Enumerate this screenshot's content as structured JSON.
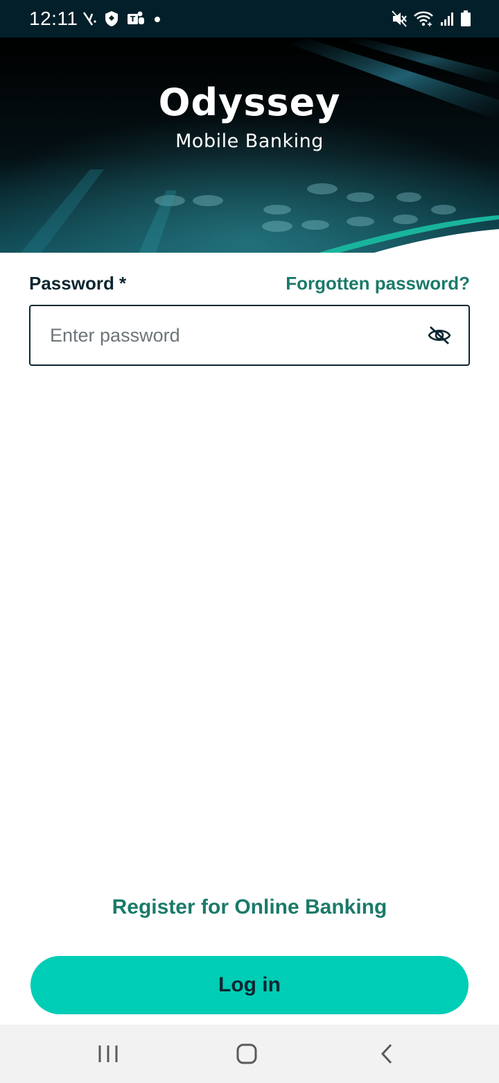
{
  "status_bar": {
    "time": "12:11",
    "left_icons": [
      "signal-slash-icon",
      "shield-icon",
      "teams-icon",
      "notification-dot-icon"
    ],
    "right_icons": [
      "mute-icon",
      "wifi-icon",
      "cell-signal-icon",
      "battery-icon"
    ]
  },
  "hero": {
    "brand_name": "Odyssey",
    "brand_tagline": "Mobile Banking"
  },
  "form": {
    "password_label": "Password *",
    "forgot_password_link": "Forgotten password?",
    "password_placeholder": "Enter password",
    "password_value": "",
    "visibility_toggle_icon": "eye-off-icon"
  },
  "register_link": "Register for Online Banking",
  "login_button": "Log in",
  "nav_bar": {
    "buttons": [
      "recent-apps-icon",
      "home-icon",
      "back-icon"
    ]
  },
  "colors": {
    "status_bar": "#03202a",
    "accent_teal": "#00cdb5",
    "link_green": "#1b7a6a",
    "text_dark": "#0d2630",
    "nav_bar": "#f2f2f2"
  }
}
